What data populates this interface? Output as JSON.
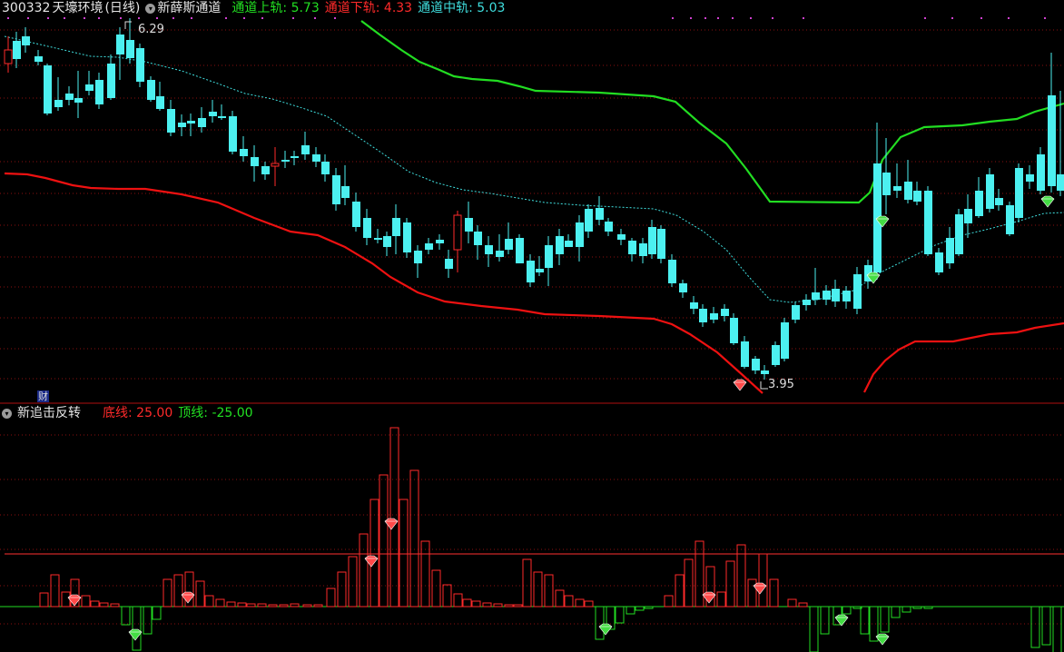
{
  "header": {
    "stock_code": "300332",
    "stock_name": "天壕环境",
    "period": "(日线)",
    "indicator_name": "新薛斯通道",
    "upper_label": "通道上轨:",
    "upper_value": "5.73",
    "lower_label": "通道下轨:",
    "lower_value": "4.33",
    "mid_label": "通道中轨:",
    "mid_value": "5.03"
  },
  "main_chart": {
    "high_marker": "6.29",
    "low_marker": "3.95",
    "finance_badge": "财",
    "colors": {
      "up": "#ff2a2a",
      "down": "#4cf0f0",
      "upper_band": "#22dd22",
      "lower_band": "#ee1111",
      "mid_band": "#3fdede"
    }
  },
  "sub_chart": {
    "indicator_name": "新追击反转",
    "bottom_label": "底线:",
    "bottom_value": "25.00",
    "top_label": "顶线:",
    "top_value": "-25.00"
  },
  "icons": {
    "indicator_toggle": "chevron-down-icon",
    "buy_signal": "red-diamond-icon",
    "sell_signal": "green-diamond-icon"
  }
}
